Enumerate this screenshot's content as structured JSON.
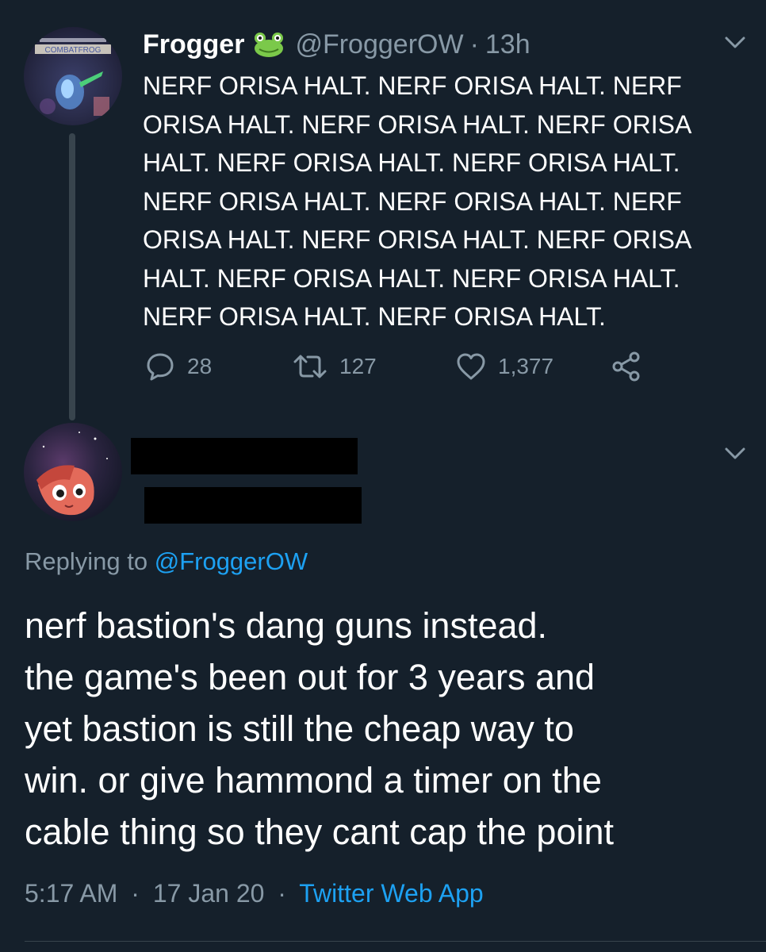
{
  "tweet": {
    "display_name": "Frogger",
    "handle": "@FroggerOW",
    "separator": "·",
    "time": "13h",
    "avatar_banner": "COMBATFROG",
    "text_lines": [
      "NERF ORISA HALT. NERF ORISA HALT. NERF",
      "ORISA HALT. NERF ORISA HALT. NERF ORISA",
      "HALT. NERF ORISA HALT. NERF ORISA HALT.",
      "NERF ORISA HALT. NERF ORISA HALT. NERF",
      "ORISA HALT. NERF ORISA HALT. NERF ORISA",
      "HALT. NERF ORISA HALT. NERF ORISA HALT.",
      "NERF ORISA HALT. NERF ORISA HALT."
    ],
    "replies": "28",
    "retweets": "127",
    "likes": "1,377",
    "icons": [
      "reply-icon",
      "retweet-icon",
      "like-icon",
      "share-icon",
      "chevron-down-icon",
      "frog-emoji-icon"
    ]
  },
  "reply": {
    "replying_label": "Replying to ",
    "replying_handle": "@FroggerOW",
    "text_lines": [
      "nerf bastion's dang guns instead.",
      "the game's been out for 3 years and",
      "yet bastion is still the cheap way to",
      "win. or give hammond a timer on the",
      "cable thing so they cant cap the point"
    ],
    "time": "5:17 AM",
    "date": "17 Jan 20",
    "separator": "·",
    "source": "Twitter Web App"
  },
  "colors": {
    "background": "#15202b",
    "text": "#ffffff",
    "muted": "#8899a6",
    "link": "#1da1f2",
    "divider": "#38444d",
    "redaction": "#000000"
  }
}
